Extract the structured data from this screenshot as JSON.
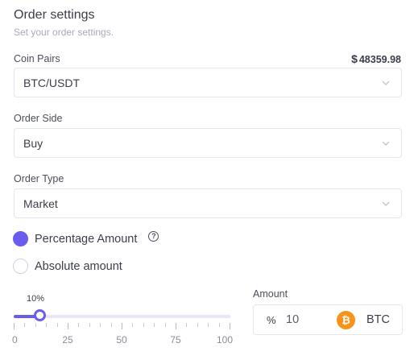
{
  "header": {
    "title": "Order settings",
    "subtitle": "Set your order settings."
  },
  "coin_pairs": {
    "label": "Coin Pairs",
    "price_currency": "$",
    "price": "48359.98",
    "value": "BTC/USDT"
  },
  "order_side": {
    "label": "Order Side",
    "value": "Buy"
  },
  "order_type": {
    "label": "Order Type",
    "value": "Market"
  },
  "amount_mode": {
    "options": [
      {
        "label": "Percentage Amount",
        "selected": true
      },
      {
        "label": "Absolute amount",
        "selected": false
      }
    ],
    "help_icon": "question-circle-icon"
  },
  "slider": {
    "value_label": "10%",
    "value_fraction": 0.12,
    "tick_labels": [
      "0",
      "25",
      "50",
      "75",
      "100"
    ]
  },
  "amount": {
    "label": "Amount",
    "prefix": "%",
    "value": "10",
    "coin_icon": "bitcoin-icon",
    "coin_symbol": "₿",
    "unit": "BTC"
  },
  "colors": {
    "accent": "#6b5cf0",
    "bitcoin": "#f7931a"
  }
}
